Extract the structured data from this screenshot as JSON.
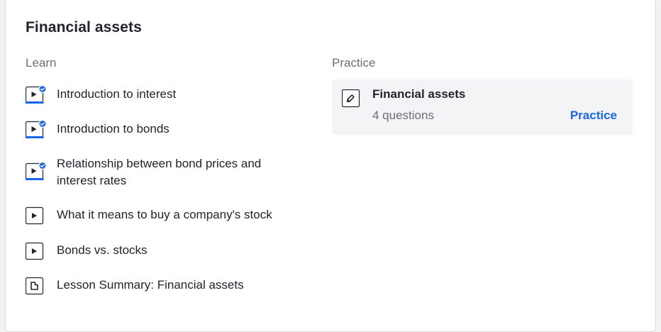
{
  "unit": {
    "title": "Financial assets"
  },
  "learn": {
    "heading": "Learn",
    "items": [
      {
        "label": "Introduction to interest",
        "type": "video",
        "completed": true
      },
      {
        "label": "Introduction to bonds",
        "type": "video",
        "completed": true
      },
      {
        "label": "Relationship between bond prices and interest rates",
        "type": "video",
        "completed": true
      },
      {
        "label": "What it means to buy a company's stock",
        "type": "video",
        "completed": false
      },
      {
        "label": "Bonds vs. stocks",
        "type": "video",
        "completed": false
      },
      {
        "label": "Lesson Summary: Financial assets",
        "type": "article",
        "completed": false
      }
    ]
  },
  "practice": {
    "heading": "Practice",
    "title": "Financial assets",
    "subtitle": "4 questions",
    "link_label": "Practice"
  },
  "colors": {
    "accent": "#1865f2",
    "text": "#21242c",
    "muted": "#6b6f76",
    "practice_bg": "#f3f4f5"
  }
}
